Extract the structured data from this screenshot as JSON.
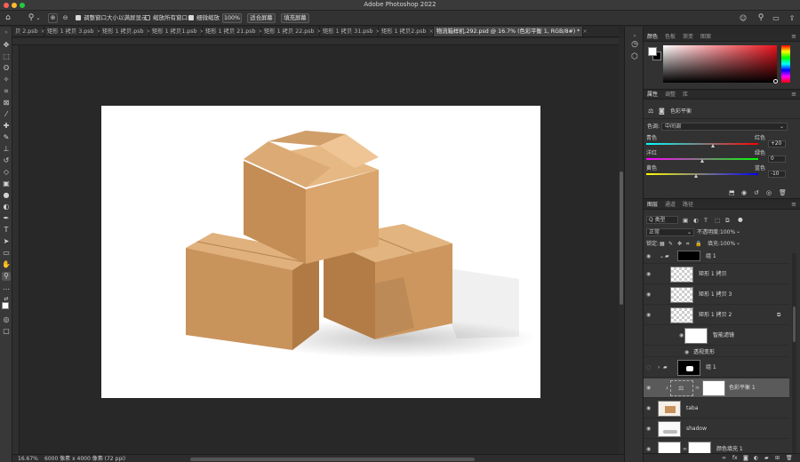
{
  "app": {
    "title": "Adobe Photoshop 2022"
  },
  "options_bar": {
    "resize_windows_label": "调整窗口大小以满屏显示",
    "resize_windows_checked": true,
    "zoom_all_label": "缩放所有窗口",
    "zoom_all_checked": false,
    "scrubby_zoom_label": "细微缩放",
    "scrubby_zoom_checked": true,
    "zoom_100_label": "100%",
    "fit_screen_label": "适合屏幕",
    "fill_screen_label": "填充屏幕"
  },
  "tabs": [
    {
      "label": "贝 2.psb",
      "active": false
    },
    {
      "label": "矩形 1 拷贝 3.psb",
      "active": false
    },
    {
      "label": "矩形 1 拷贝.psb",
      "active": false
    },
    {
      "label": "矩形 1 拷贝1.psb",
      "active": false
    },
    {
      "label": "矩形 1 拷贝 21.psb",
      "active": false
    },
    {
      "label": "矩形 1 拷贝 22.psb",
      "active": false
    },
    {
      "label": "矩形 1 拷贝 31.psb",
      "active": false
    },
    {
      "label": "矩形 1 拷贝2.psb",
      "active": false
    },
    {
      "label": "物流箱样机.292.psd @ 16.7% (色彩平衡 1, RGB/8#) *",
      "active": true
    }
  ],
  "status": {
    "zoom": "16.67%",
    "doc_size": "6000 像素 x 4000 像素 (72 ppi)"
  },
  "color_panel": {
    "tabs": [
      "颜色",
      "色板",
      "渐变",
      "图案"
    ],
    "active_tab": "颜色",
    "foreground": "#ffffff",
    "background": "#000000"
  },
  "properties_panel": {
    "tabs": [
      "属性",
      "调整",
      "库"
    ],
    "active_tab": "属性",
    "adjustment_name": "色彩平衡",
    "tone_label": "色调:",
    "tone_value": "中间调",
    "sliders": [
      {
        "left": "青色",
        "right": "红色",
        "value": "+20",
        "fraction": 0.6
      },
      {
        "left": "洋红",
        "right": "绿色",
        "value": "0",
        "fraction": 0.5
      },
      {
        "left": "黄色",
        "right": "蓝色",
        "value": "-10",
        "fraction": 0.45
      }
    ]
  },
  "layers_panel": {
    "tabs": [
      "图层",
      "通道",
      "路径"
    ],
    "active_tab": "图层",
    "filter_label": "Q 类型",
    "blend_mode": "正常",
    "opacity_label": "不透明度:",
    "opacity_value": "100%",
    "lock_label": "锁定:",
    "fill_label": "填充:",
    "fill_value": "100%",
    "layers": [
      {
        "name": "组 1",
        "type": "group-top"
      },
      {
        "name": "矩形 1 拷贝",
        "type": "smart"
      },
      {
        "name": "矩形 1 拷贝 3",
        "type": "smart"
      },
      {
        "name": "矩形 1 拷贝 2",
        "type": "smart"
      },
      {
        "name": "智能滤镜",
        "type": "filter"
      },
      {
        "name": "透视变形",
        "type": "filter-item"
      },
      {
        "name": "组 1",
        "type": "group"
      },
      {
        "name": "色彩平衡 1",
        "type": "adjustment",
        "selected": true
      },
      {
        "name": "taba",
        "type": "image"
      },
      {
        "name": "shadow",
        "type": "image2"
      },
      {
        "name": "颜色填充 1",
        "type": "fill"
      }
    ]
  },
  "colors": {
    "cardboard_light": "#d9a873",
    "cardboard_mid": "#c8925c",
    "cardboard_dark": "#a8743f",
    "selection": "#5a5a5a"
  }
}
